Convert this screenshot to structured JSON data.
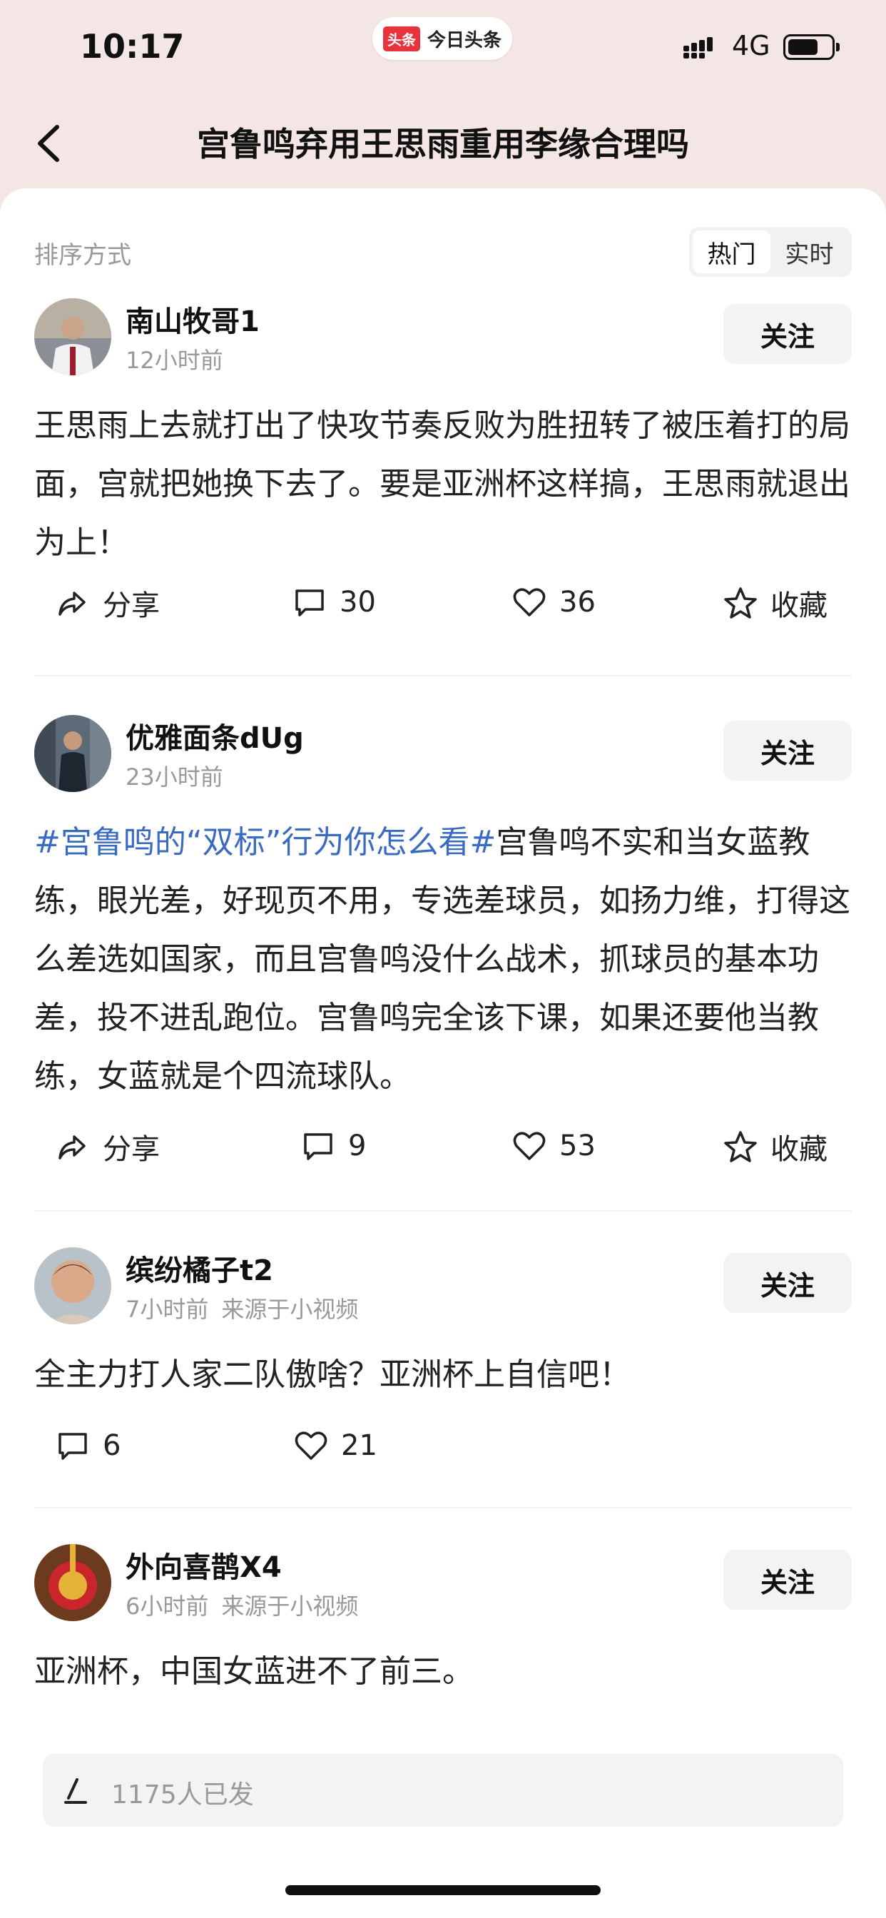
{
  "status": {
    "time": "10:17",
    "app_logo": "头条",
    "app_name": "今日头条",
    "network": "4G",
    "battery_level": 0.7
  },
  "header": {
    "title": "宫鲁鸣弃用王思雨重用李缘合理吗",
    "back_icon": "chevron-left-icon"
  },
  "sort": {
    "label": "排序方式",
    "options": [
      "热门",
      "实时"
    ],
    "active": "热门"
  },
  "posts": [
    {
      "author": "南山牧哥1",
      "time": "12小时前",
      "source": "",
      "follow": "关注",
      "text": "王思雨上去就打出了快攻节奏反败为胜扭转了被压着打的局面，宫就把她换下去了。要是亚洲杯这样搞，王思雨就退出为上！",
      "share": "分享",
      "comments": "30",
      "likes": "36",
      "favorite": "收藏"
    },
    {
      "author": "优雅面条dUg",
      "time": "23小时前",
      "source": "",
      "follow": "关注",
      "hashtag": "#宫鲁鸣的“双标”行为你怎么看#",
      "text": "宫鲁鸣不实和当女蓝教练，眼光差，好现页不用，专选差球员，如扬力维，打得这么差选如国家，而且宫鲁鸣没什么战术，抓球员的基本功差，投不进乱跑位。宫鲁鸣完全该下课，如果还要他当教练，女蓝就是个四流球队。",
      "share": "分享",
      "comments": "9",
      "likes": "53",
      "favorite": "收藏"
    },
    {
      "author": "缤纷橘子t2",
      "time": "7小时前",
      "source": "来源于小视频",
      "follow": "关注",
      "text": "全主力打人家二队傲啥？亚洲杯上自信吧！",
      "comments": "6",
      "likes": "21"
    },
    {
      "author": "外向喜鹊X4",
      "time": "6小时前",
      "source": "来源于小视频",
      "follow": "关注",
      "text": "亚洲杯，中国女蓝进不了前三。"
    }
  ],
  "composer": {
    "placeholder": "1175人已发"
  }
}
